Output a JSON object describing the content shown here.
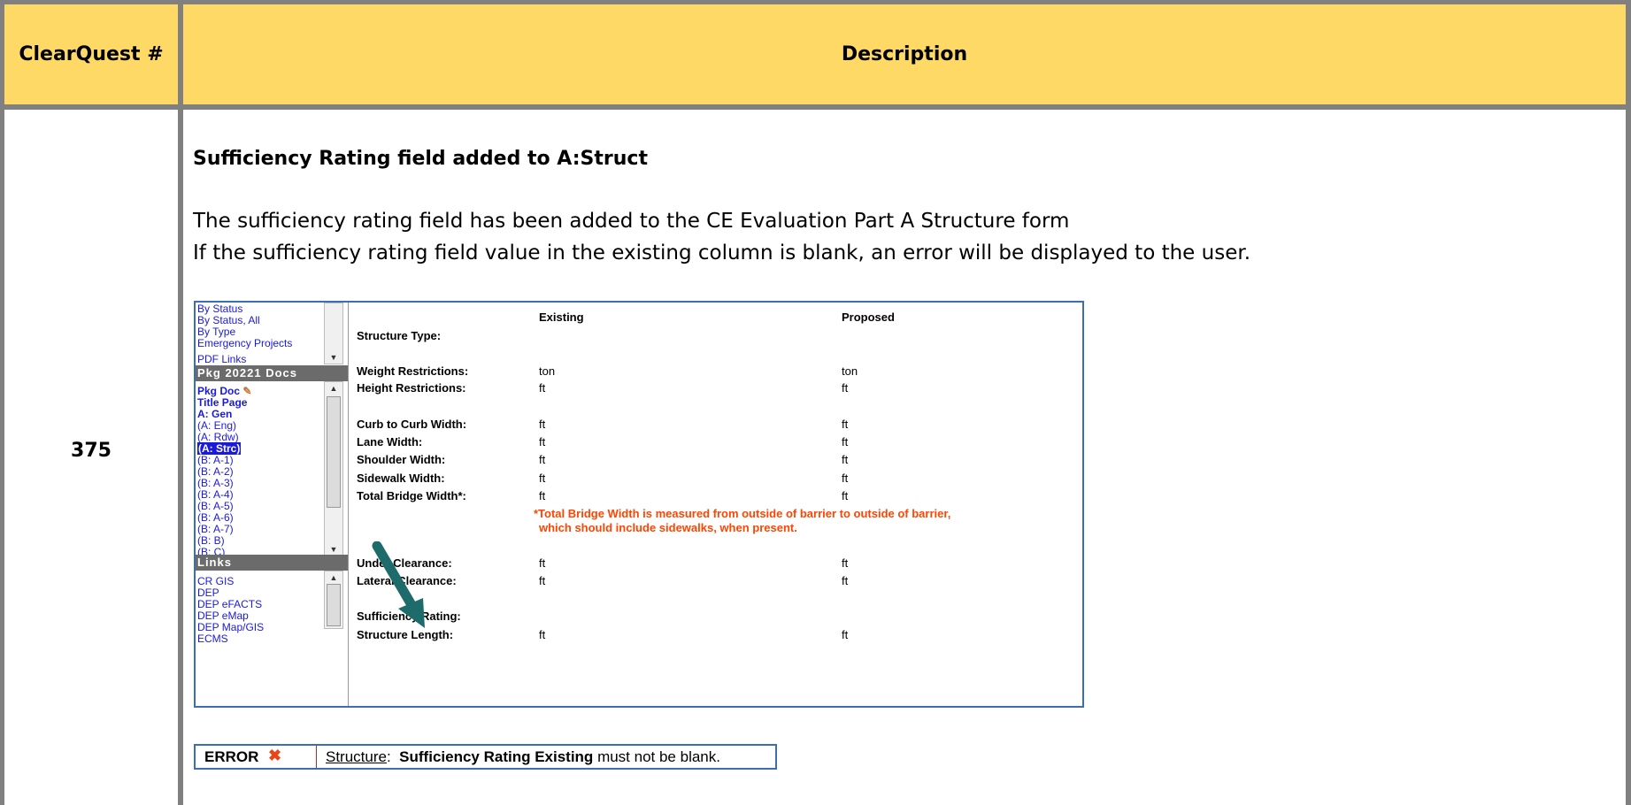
{
  "header": {
    "col1": "ClearQuest #",
    "col2": "Description"
  },
  "row": {
    "number": "375",
    "title": "Sufficiency Rating field added to A:Struct",
    "para1": "The sufficiency rating field has been added to the CE Evaluation Part A Structure form",
    "para2": "If the sufficiency rating field value in the existing column is blank, an error will be displayed to the user."
  },
  "screenshot": {
    "sidebar_top": [
      "By Status",
      "By Status, All",
      "By Type",
      "Emergency Projects",
      "PDF Links"
    ],
    "docs_header": "Pkg 20221 Docs",
    "docs": [
      "Pkg Doc",
      "Title Page",
      "A: Gen",
      "(A: Eng)",
      "(A: Rdw)",
      "(A: Strc)",
      "(B: A-1)",
      "(B: A-2)",
      "(B: A-3)",
      "(B: A-4)",
      "(B: A-5)",
      "(B: A-6)",
      "(B: A-7)",
      "(B: B)",
      "(B: C)"
    ],
    "links_header": "Links",
    "links": [
      "CR GIS",
      "DEP",
      "DEP eFACTS",
      "DEP eMap",
      "DEP Map/GIS",
      "ECMS"
    ],
    "col_existing": "Existing",
    "col_proposed": "Proposed",
    "fields": [
      {
        "label": "Structure Type:",
        "existing": "",
        "proposed": ""
      },
      {
        "label": "Weight Restrictions:",
        "existing": "ton",
        "proposed": "ton"
      },
      {
        "label": "Height Restrictions:",
        "existing": "ft",
        "proposed": "ft"
      },
      {
        "label": "Curb to Curb Width:",
        "existing": "ft",
        "proposed": "ft"
      },
      {
        "label": "Lane Width:",
        "existing": "ft",
        "proposed": "ft"
      },
      {
        "label": "Shoulder Width:",
        "existing": "ft",
        "proposed": "ft"
      },
      {
        "label": "Sidewalk Width:",
        "existing": "ft",
        "proposed": "ft"
      },
      {
        "label": "Total Bridge Width*:",
        "existing": "ft",
        "proposed": "ft"
      },
      {
        "label": "Under Clearance:",
        "existing": "ft",
        "proposed": "ft"
      },
      {
        "label": "Lateral Clearance:",
        "existing": "ft",
        "proposed": "ft"
      },
      {
        "label": "Sufficiency Rating:",
        "existing": "",
        "proposed": ""
      },
      {
        "label": "Structure Length:",
        "existing": "ft",
        "proposed": "ft"
      }
    ],
    "note1": "*Total Bridge Width is measured from outside of barrier to outside of barrier,",
    "note2": "which should include sidewalks, when present."
  },
  "error": {
    "label": "ERROR",
    "icon": "x-icon",
    "link": "Structure",
    "sep": ":",
    "field": "Sufficiency Rating Existing",
    "rest": "must not be blank."
  },
  "colors": {
    "header_bg": "#ffd966",
    "border": "#808080",
    "link": "#1a1adb",
    "note": "#ff4500",
    "arrow": "#1e6b6b"
  }
}
